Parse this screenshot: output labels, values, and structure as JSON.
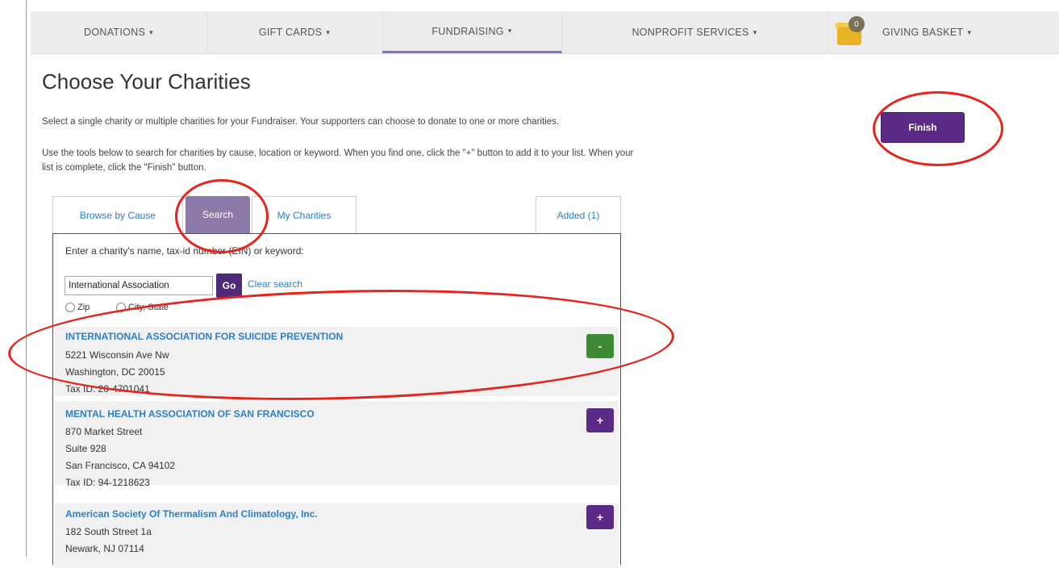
{
  "nav": {
    "items": [
      {
        "label": "DONATIONS"
      },
      {
        "label": "GIFT CARDS"
      },
      {
        "label": "FUNDRAISING"
      },
      {
        "label": "NONPROFIT SERVICES"
      },
      {
        "label": "GIVING BASKET"
      }
    ],
    "caret": "▾",
    "basket_count": "0"
  },
  "page": {
    "title": "Choose Your Charities",
    "intro1": "Select a single charity or multiple charities for your Fundraiser. Your supporters can choose to donate to one or more charities.",
    "intro2a": "Use the tools below to search for charities by cause, location or keyword. When you find one, click the \"+\" button to add it to your list. When your",
    "intro2b": "list is complete, click the \"Finish\" button.",
    "finish_label": "Finish"
  },
  "tabs": [
    {
      "label": "Browse by Cause"
    },
    {
      "label": "Search"
    },
    {
      "label": "My Charities"
    },
    {
      "label": "Added (1)"
    }
  ],
  "search": {
    "prompt": "Enter a charity's name, tax-id number (EIN) or keyword:",
    "value": "International Association",
    "go_label": "Go",
    "clear_label": "Clear search",
    "radio_zip": "Zip",
    "radio_city": "City, State"
  },
  "results": [
    {
      "name": "INTERNATIONAL ASSOCIATION FOR SUICIDE PREVENTION",
      "lines": [
        "5221 Wisconsin Ave Nw",
        "Washington, DC 20015",
        "Tax ID: 20-4701041"
      ],
      "action": "-"
    },
    {
      "name": "MENTAL HEALTH ASSOCIATION OF SAN FRANCISCO",
      "lines": [
        "870 Market Street",
        "Suite 928",
        "San Francisco, CA 94102",
        "Tax ID: 94-1218623"
      ],
      "action": "+"
    },
    {
      "name": "American Society Of Thermalism And Climatology, Inc.",
      "lines": [
        "182 South Street 1a",
        "Newark, NJ 07114"
      ],
      "action": "+"
    }
  ],
  "colors": {
    "accent": "#5b2a86",
    "link": "#2d7fc9",
    "remove": "#3d8b35",
    "annotation": "#e8231c"
  }
}
